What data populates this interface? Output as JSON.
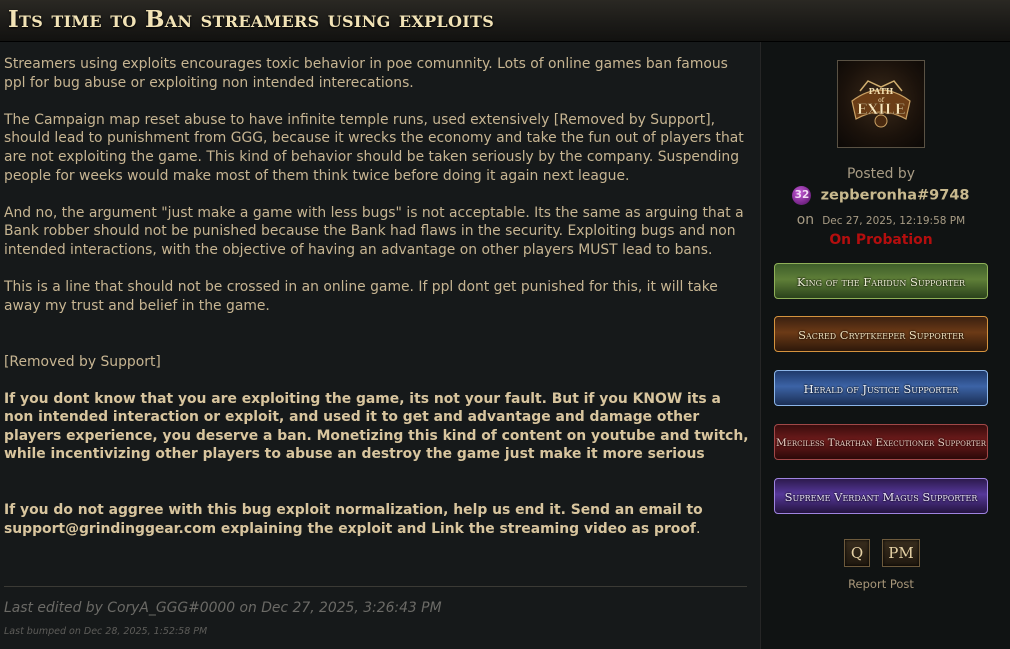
{
  "thread": {
    "title": "Its time to Ban streamers using exploits"
  },
  "post": {
    "paragraphs": [
      "Streamers using exploits encourages toxic behavior in poe comunnity. Lots of online games ban famous ppl for bug abuse or exploiting non intended interecations.",
      "The Campaign map reset abuse to have infinite temple runs, used extensively [Removed by Support], should lead to punishment from GGG, because it wrecks the economy and take the fun out of players that are not exploiting the game. This kind of behavior should be taken seriously by the company. Suspending people for weeks would make most of them think twice before doing it again next league.",
      "And no, the argument \"just make a game with less bugs\" is not acceptable. Its the same as arguing that a Bank robber should not be punished because the Bank had flaws in the security. Exploiting bugs and non intended interactions, with the objective of having an advantage on other players MUST lead to bans.",
      "This is a line that should not be crossed in an online game. If ppl dont get punished for this, it will take away my trust and belief in the game.",
      "[Removed by Support]"
    ],
    "bold_paragraph_1": "If you dont know that you are exploiting the game, its not your fault. But if you KNOW its a non intended interaction or exploit, and used it to get and advantage and damage other players experience, you deserve a ban. Monetizing this kind of content on youtube and twitch, while incentivizing other players to abuse an destroy the game just make it more serious",
    "bold_paragraph_2": "If you do not aggree with this bug exploit normalization, help us end it. Send an email to support@grindinggear.com explaining the exploit and Link the streaming video as proof",
    "bold_paragraph_2_end": ".",
    "last_edited": "Last edited by CoryA_GGG#0000 on Dec 27, 2025, 3:26:43 PM",
    "last_bumped": "Last bumped on Dec 28, 2025, 1:52:58 PM"
  },
  "author": {
    "posted_by_label": "Posted by",
    "level": "32",
    "username": "zepberonha#9748",
    "on_label": "on",
    "date": "Dec 27, 2025, 12:19:58 PM",
    "status": "On Probation",
    "badges": [
      "King of the Faridun Supporter",
      "Sacred Cryptkeeper Supporter",
      "Herald of Justice Supporter",
      "Merciless Trarthan Executioner Supporter",
      "Supreme Verdant Magus Supporter"
    ]
  },
  "actions": {
    "quote_label": "Q",
    "pm_label": "PM",
    "report_label": "Report Post"
  },
  "avatar": {
    "line1": "PATH",
    "line2": "of",
    "line3": "EXILE"
  }
}
